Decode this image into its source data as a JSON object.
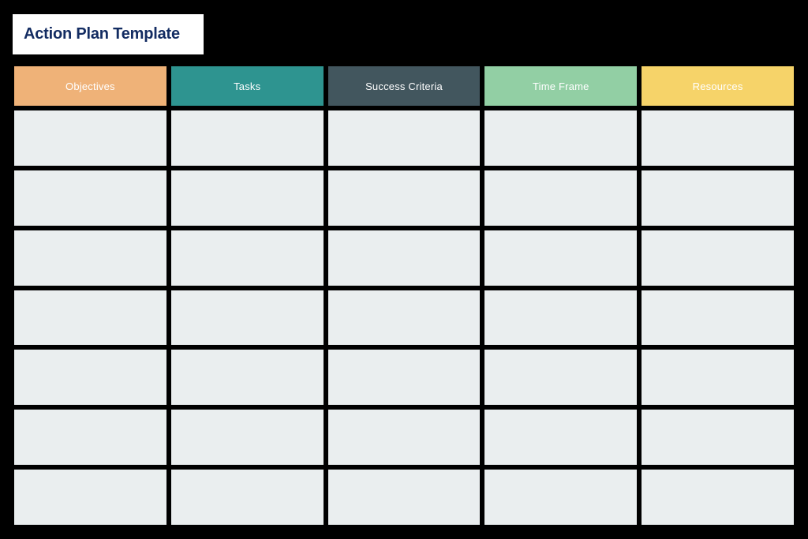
{
  "document": {
    "title": "Action Plan Template",
    "background_color": "#000000",
    "title_box_color": "#FFFFFF",
    "title_text_color": "#132C62"
  },
  "table": {
    "columns": [
      {
        "label": "Objectives",
        "header_color": "#EFB278"
      },
      {
        "label": "Tasks",
        "header_color": "#2E9490"
      },
      {
        "label": "Success Criteria",
        "header_color": "#42565E"
      },
      {
        "label": "Time Frame",
        "header_color": "#92CFA4"
      },
      {
        "label": "Resources",
        "header_color": "#F6D369"
      }
    ],
    "cell_color": "#EAEEEF",
    "row_count": 7,
    "rows": [
      {
        "cells": [
          "",
          "",
          "",
          "",
          ""
        ]
      },
      {
        "cells": [
          "",
          "",
          "",
          "",
          ""
        ]
      },
      {
        "cells": [
          "",
          "",
          "",
          "",
          ""
        ]
      },
      {
        "cells": [
          "",
          "",
          "",
          "",
          ""
        ]
      },
      {
        "cells": [
          "",
          "",
          "",
          "",
          ""
        ]
      },
      {
        "cells": [
          "",
          "",
          "",
          "",
          ""
        ]
      },
      {
        "cells": [
          "",
          "",
          "",
          "",
          ""
        ]
      }
    ]
  }
}
